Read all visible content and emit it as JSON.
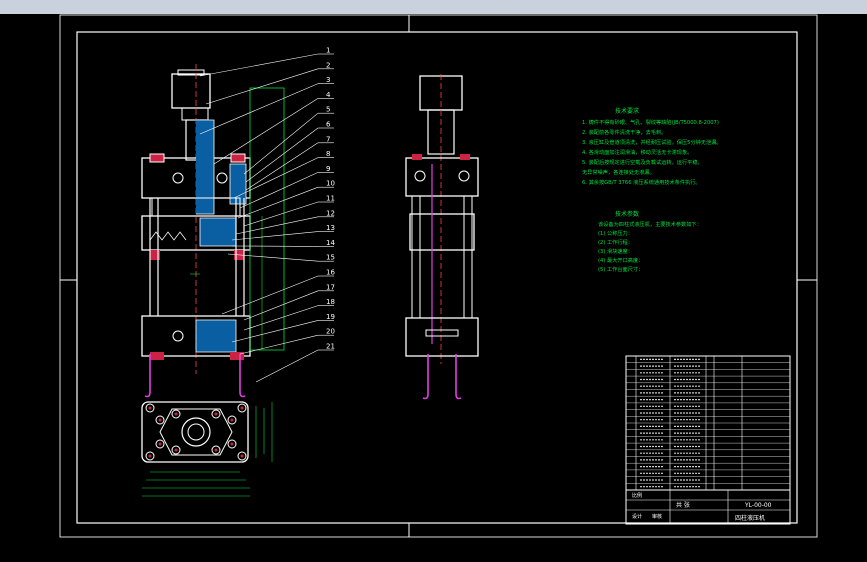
{
  "drawing": {
    "balloons": [
      "1",
      "2",
      "3",
      "4",
      "5",
      "6",
      "7",
      "8",
      "9",
      "10",
      "11",
      "12",
      "13",
      "14",
      "15",
      "16",
      "17",
      "18",
      "19",
      "20",
      "21"
    ],
    "notes_title": "技术要求",
    "notes_lines": [
      "1. 铸件不得有砂眼、气孔、裂纹等缺陷(JB/T5000.8-2007)",
      "2. 装配前各零件清洗干净，去毛刺。",
      "3. 液压缸及管道须清洗，并经耐压试验，保压5分钟无泄漏。",
      "4. 各滑动面加注润滑油，移动灵活无卡滞现象。",
      "5. 装配后按规定进行空载及负载试运转，运行平稳，",
      "   无异常噪声，各连接处无渗漏。",
      "6. 其余按GB/T 3766 液压系统通用技术条件执行。"
    ],
    "perf_title": "技术参数",
    "perf_lines": [
      "该设备为四柱式液压机，主要技术参数如下：",
      "(1) 公称压力：",
      "(2) 工作行程：",
      "(3) 滑块速度：",
      "(4) 最大开口高度：",
      "(5) 工作台面尺寸："
    ],
    "title_block": {
      "drawing_no": "YL-00-00",
      "label_a": "比例",
      "label_b": "共 张",
      "label_c": "设计",
      "label_d": "审核",
      "product": "四柱液压机"
    }
  }
}
